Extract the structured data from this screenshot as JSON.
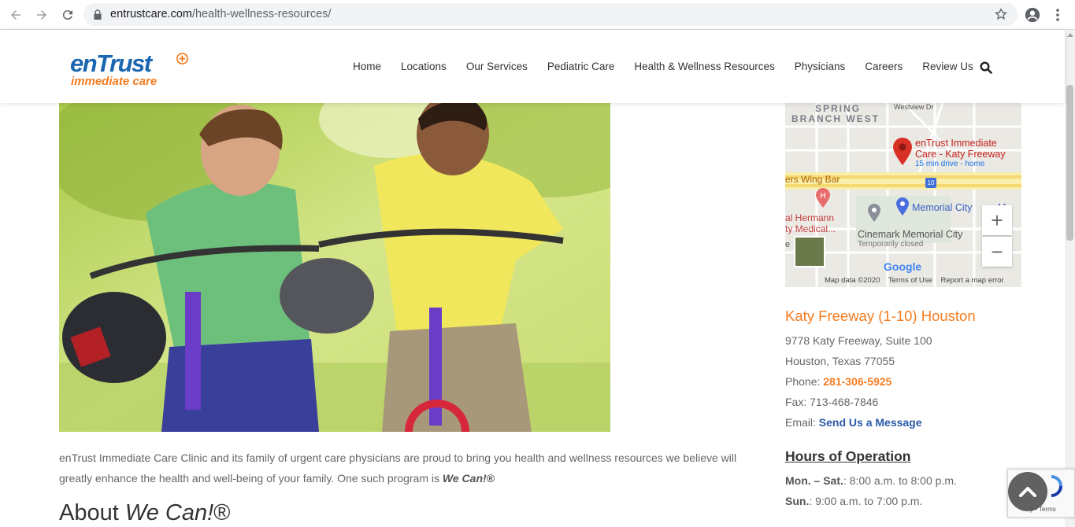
{
  "browser": {
    "url_domain": "entrustcare.com",
    "url_path": "/health-wellness-resources/"
  },
  "logo": {
    "brand": "enTrust",
    "tagline": "immediate care"
  },
  "nav": {
    "items": [
      {
        "label": "Home"
      },
      {
        "label": "Locations"
      },
      {
        "label": "Our Services"
      },
      {
        "label": "Pediatric Care"
      },
      {
        "label": "Health & Wellness Resources"
      },
      {
        "label": "Physicians"
      },
      {
        "label": "Careers"
      },
      {
        "label": "Review Us"
      }
    ]
  },
  "content": {
    "intro_text": "enTrust Immediate Care Clinic and its family of urgent care physicians are proud to bring you health and wellness resources we believe will greatly enhance the health and well-being of your family. One such program is ",
    "intro_program": "We Can!®",
    "about_prefix": "About ",
    "about_em": "We Can!",
    "about_suffix": "®"
  },
  "map": {
    "area_label_1": "SPRING",
    "area_label_2": "BRANCH WEST",
    "street_label": "Westview Dr",
    "pin_title_1": "enTrust Immediate",
    "pin_title_2": "Care - Katy Freeway",
    "pin_subtitle": "15 min drive - home",
    "wing_bar": "ers Wing Bar",
    "highway_shield": "10",
    "hospital_1": "al Hermann",
    "hospital_2": "ty Medical...",
    "memorial_city": "Memorial City",
    "memorial_city_cut": "Mall",
    "cinemark": "Cinemark Memorial City",
    "cinemark_status": "Temporarily closed",
    "letter_e": "e",
    "google": "Google",
    "zoom_in": "+",
    "zoom_out": "−",
    "footer_data": "Map data ©2020",
    "footer_terms": "Terms of Use",
    "footer_report": "Report a map error"
  },
  "location": {
    "title": "Katy Freeway (1-10) Houston",
    "street": "9778 Katy Freeway, Suite 100",
    "city": "Houston, Texas 77055",
    "phone_label": "Phone: ",
    "phone": "281-306-5925",
    "fax": "Fax: 713-468-7846",
    "email_label": "Email: ",
    "email_link": "Send Us a Message"
  },
  "hours": {
    "title": "Hours of Operation",
    "rows": [
      {
        "days": "Mon. – Sat.",
        "time": ": 8:00 a.m. to 8:00 p.m."
      },
      {
        "days": "Sun.",
        "time": ":  9:00 a.m. to 7:00 p.m."
      }
    ]
  },
  "recaptcha": {
    "terms": "y - Terms"
  },
  "colors": {
    "brand_blue": "#1b66b0",
    "brand_orange": "#f47c20",
    "link_blue": "#2a5aa8"
  }
}
